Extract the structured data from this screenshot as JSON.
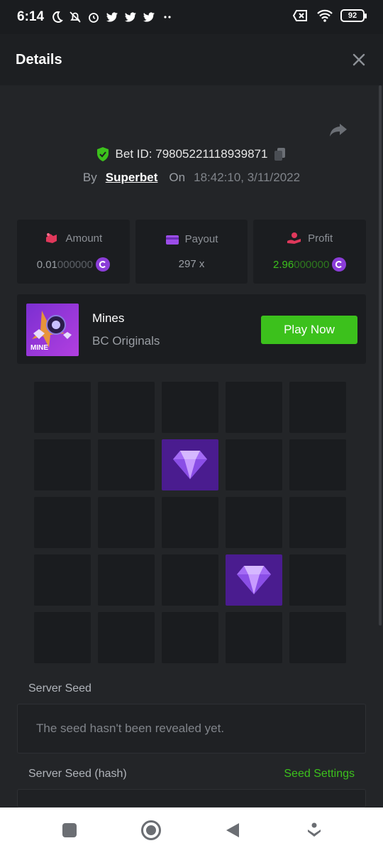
{
  "status_bar": {
    "time": "6:14",
    "battery": "92"
  },
  "header": {
    "title": "Details"
  },
  "bet": {
    "id_label": "Bet ID: 79805221118939871",
    "by_label": "By",
    "user": "Superbet",
    "on_label": "On",
    "timestamp": "18:42:10, 3/11/2022"
  },
  "stats": {
    "amount_label": "Amount",
    "amount_value_main": "0.01",
    "amount_value_dim": "000000",
    "payout_label": "Payout",
    "payout_value": "297 x",
    "profit_label": "Profit",
    "profit_value_main": "2.96",
    "profit_value_dim": "000000"
  },
  "game": {
    "thumb_text": "MINE",
    "name": "Mines",
    "provider": "BC Originals",
    "play_label": "Play Now"
  },
  "grid": {
    "rows": 5,
    "cols": 5,
    "gems": [
      7,
      18
    ]
  },
  "seeds": {
    "server_seed_label": "Server Seed",
    "server_seed_value": "The seed hasn't been revealed yet.",
    "server_hash_label": "Server Seed (hash)",
    "seed_settings_label": "Seed Settings"
  },
  "colors": {
    "accent_green": "#3cc11c",
    "gem_bg": "#4a1c8f",
    "coin": "#8b3dd8"
  }
}
